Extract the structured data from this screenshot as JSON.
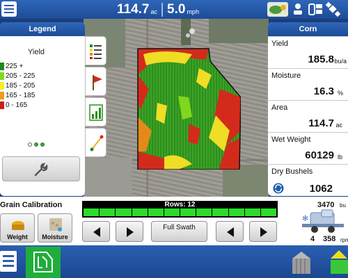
{
  "topbar": {
    "area_value": "114.7",
    "area_unit": "ac",
    "speed_value": "5.0",
    "speed_unit": "mph",
    "icons": [
      "menu-icon",
      "gps-status-icon",
      "connection-icon",
      "display-toggle-icon",
      "satellite-icon"
    ]
  },
  "legend": {
    "title": "Legend",
    "attribute": "Yield",
    "items": [
      {
        "label": "225 +",
        "color": "#1c8a1c"
      },
      {
        "label": "205 - 225",
        "color": "#7fd81e"
      },
      {
        "label": "185 - 205",
        "color": "#f3ef2b"
      },
      {
        "label": "165 - 185",
        "color": "#f09a1e"
      },
      {
        "label": "0 - 165",
        "color": "#cc1c1c"
      }
    ],
    "pages": 3,
    "active_page": 3
  },
  "side_tabs": [
    "legend-icon",
    "flag-icon",
    "chart-icon",
    "guidance-icon"
  ],
  "panel": {
    "title": "Corn",
    "rows": [
      {
        "label": "Yield",
        "value": "185.8",
        "unit": "bu/a"
      },
      {
        "label": "Moisture",
        "value": "16.3",
        "unit": "%"
      },
      {
        "label": "Area",
        "value": "114.7",
        "unit": "ac"
      },
      {
        "label": "Wet Weight",
        "value": "60129",
        "unit": "lb"
      },
      {
        "label": "Dry Bushels",
        "value": "1062",
        "unit": ""
      }
    ]
  },
  "grain_calibration": {
    "title": "Grain Calibration",
    "weight_label": "Weight",
    "moisture_label": "Moisture"
  },
  "rows_control": {
    "label": "Rows: 12",
    "count": 12,
    "full_swath_label": "Full Swath"
  },
  "machine": {
    "bushels_value": "3470",
    "bushels_unit": "bu",
    "left_value": "4",
    "rpm_value": "358",
    "rpm_unit": "rpm"
  },
  "colors": {
    "header_blue": "#1d4c98",
    "nav_green": "#1fae3b",
    "row_green": "#2bdc2b"
  }
}
